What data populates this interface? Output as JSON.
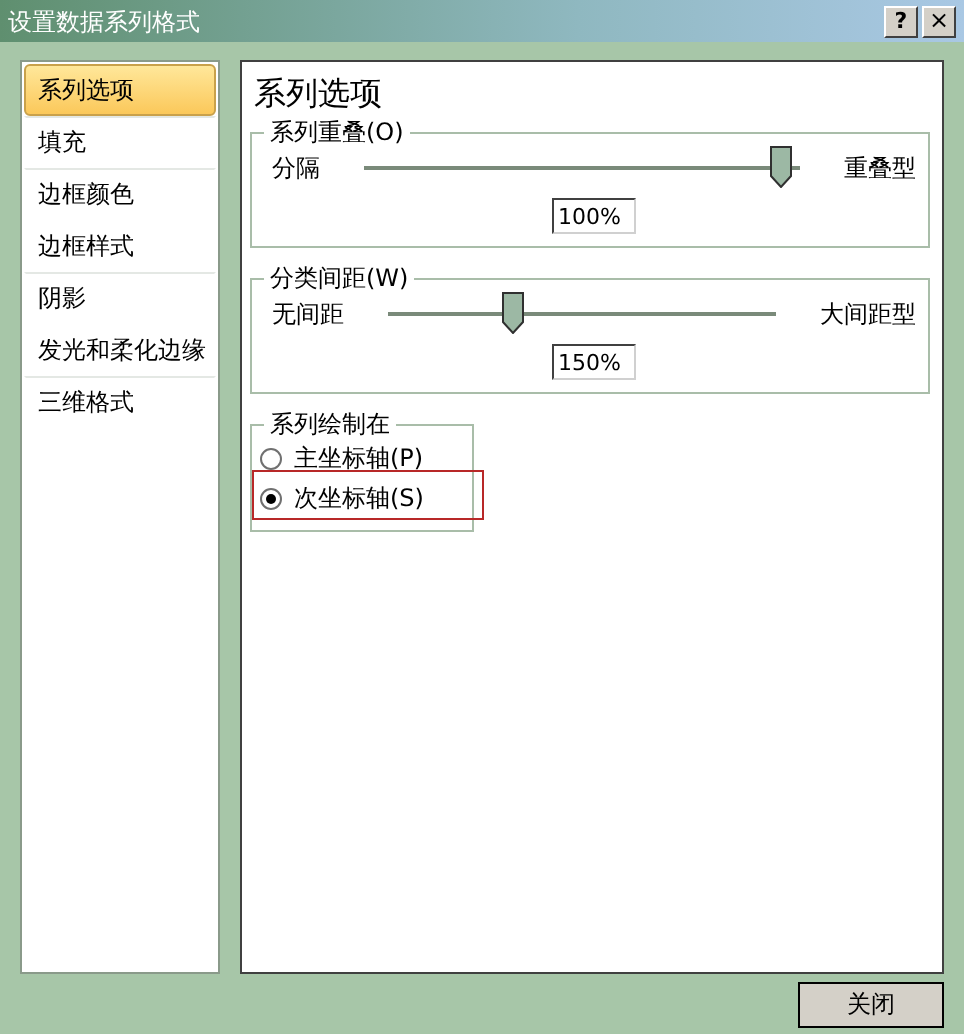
{
  "window": {
    "title": "设置数据系列格式",
    "buttons": [
      {
        "kind": "help",
        "label": "?"
      },
      {
        "kind": "close",
        "label": "×"
      }
    ]
  },
  "sidebar": {
    "items": [
      {
        "label": "系列选项",
        "selected": true,
        "group_start": false
      },
      {
        "label": "填充",
        "selected": false,
        "group_start": true
      },
      {
        "label": "边框颜色",
        "selected": false,
        "group_start": true
      },
      {
        "label": "边框样式",
        "selected": false,
        "group_start": false
      },
      {
        "label": "阴影",
        "selected": false,
        "group_start": true
      },
      {
        "label": "发光和柔化边缘",
        "selected": false,
        "group_start": false
      },
      {
        "label": "三维格式",
        "selected": false,
        "group_start": true
      }
    ]
  },
  "panel": {
    "title": "系列选项",
    "sliders": [
      {
        "legend": "系列重叠(O)",
        "min_label": "分隔",
        "max_label": "重叠型",
        "level": 0.98,
        "value": "100%"
      },
      {
        "legend": "分类间距(W)",
        "min_label": "无间距",
        "max_label": "大间距型",
        "level": 0.31,
        "value": "150%"
      }
    ],
    "plot_on": {
      "legend": "系列绘制在",
      "options": [
        {
          "label": "主坐标轴(P)",
          "selected": false,
          "highlighted": false
        },
        {
          "label": "次坐标轴(S)",
          "selected": true,
          "highlighted": true
        }
      ]
    }
  },
  "footer": {
    "buttons": [
      "关闭"
    ]
  }
}
